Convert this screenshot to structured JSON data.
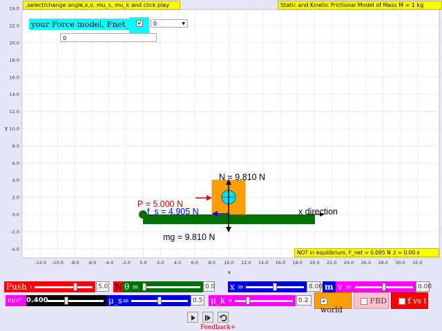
{
  "header": {
    "left_hint": ",select/change angle,x,v, mu_s, mu_k and click play",
    "right_title": "Static and Kinetic Frictional Model of Mass M = 1 kg"
  },
  "force_model": {
    "label": "your Force model, Fnet_x =",
    "checked": true,
    "select_value": "0",
    "input_value": "0"
  },
  "plot": {
    "xlabel": "x",
    "ylabel": "y",
    "x_ticks": [
      "-12.0",
      "-10.0",
      "-8.0",
      "-6.0",
      "-4.0",
      "-2.0",
      "0.0",
      "2.0",
      "4.0",
      "6.0",
      "8.0",
      "10.0",
      "12.0",
      "14.0",
      "16.0",
      "18.0",
      "20.0",
      "22.0",
      "24.0",
      "26.0",
      "28.0",
      "30.0",
      "32.0"
    ],
    "y_ticks": [
      "-4.0",
      "-2.0",
      "0.0",
      "2.0",
      "4.0",
      "6.0",
      "8.0",
      "10.0",
      "12.0",
      "14.0",
      "16.0",
      "18.0",
      "20.0",
      "22.0",
      "24.0"
    ],
    "labels": {
      "normal": "N = 9.810 N",
      "push": "P = 5.000 N",
      "friction": "f_s = 4.905 N",
      "direction": "x direction",
      "weight": "mg = 9.810 N"
    },
    "status": "NOT in equilibrium, F_net = 0.095 N ,t = 0.00 s"
  },
  "controls_row1": {
    "push_label": "Push =",
    "push_value": "5.0",
    "push_fraction": 0.72,
    "push_unit": "N",
    "theta_label": "θ =",
    "theta_value": "0.0",
    "theta_fraction": 0.0,
    "x_label": "x =",
    "x_value": "8.00",
    "x_fraction": 0.5,
    "m_label": "m",
    "v_label": "v =",
    "v_value": "0.00",
    "v_fraction": 0.5
  },
  "controls_row2": {
    "g_label": "m/s²",
    "g_value": "0.400",
    "g_fraction": 0.5,
    "mus_label": "μ_s=",
    "mus_value": "0.5",
    "mus_fraction": 0.5,
    "muk_label": "μ_k =",
    "muk_value": "0.2",
    "muk_fraction": 0.2,
    "world_label": "world",
    "fbd_label": "FBD",
    "fvst_label": "f vs t"
  },
  "footer": {
    "feedback": "Feedback+"
  },
  "colors": {
    "mass": "#ffa000",
    "ground": "#007000",
    "push": "#e60000",
    "friction": "#0000dd"
  }
}
